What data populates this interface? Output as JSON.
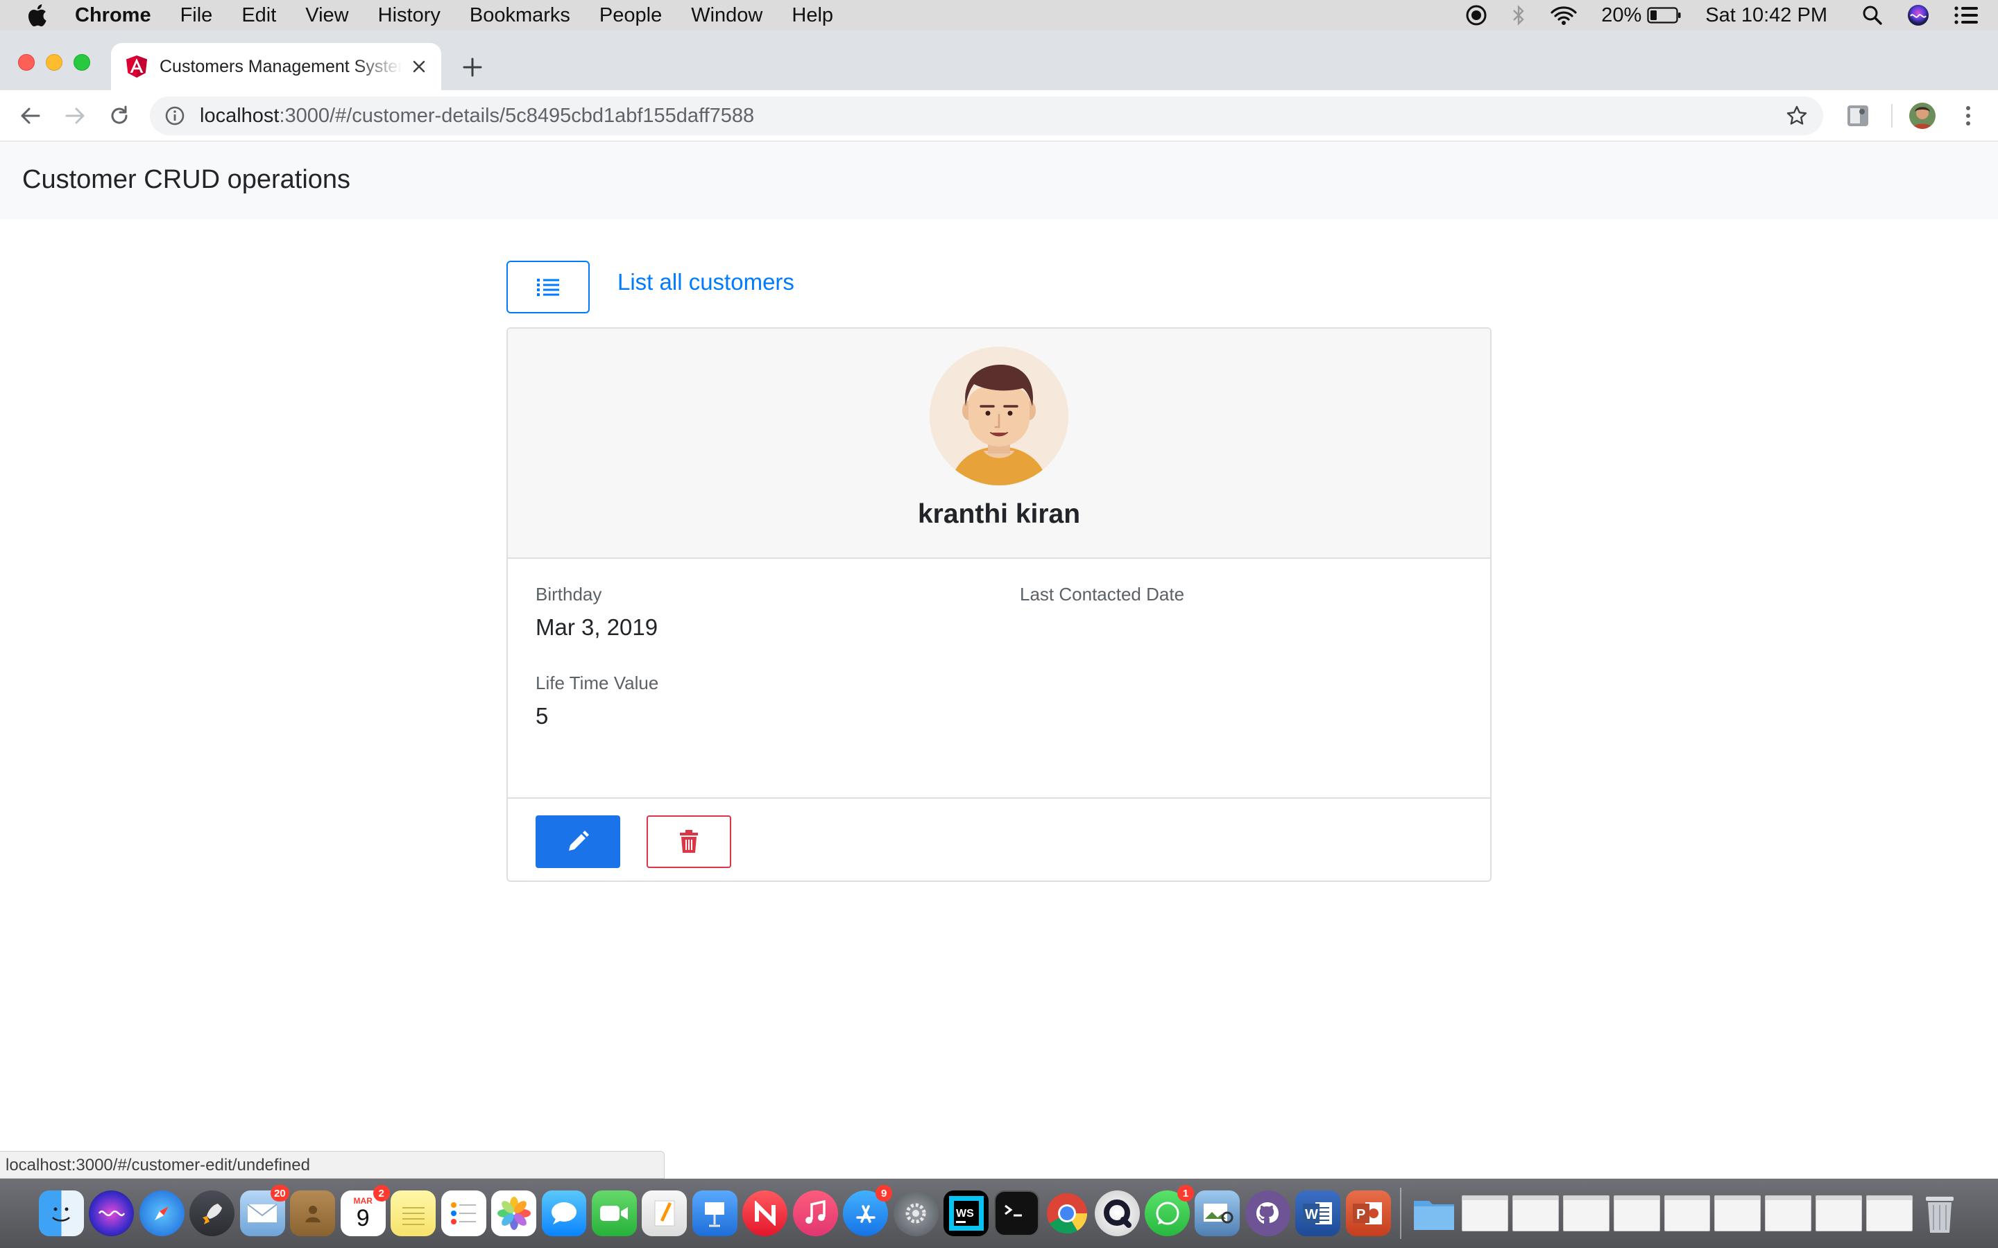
{
  "menubar": {
    "app_name": "Chrome",
    "items": [
      "File",
      "Edit",
      "View",
      "History",
      "Bookmarks",
      "People",
      "Window",
      "Help"
    ],
    "battery": "20%",
    "clock": "Sat 10:42 PM"
  },
  "browser": {
    "tab_title": "Customers Management System",
    "url_host": "localhost",
    "url_path": ":3000/#/customer-details/5c8495cbd1abf155daff7588",
    "status_url": "localhost:3000/#/customer-edit/undefined"
  },
  "app": {
    "brand": "Customer CRUD operations",
    "list_link": "List all customers"
  },
  "customer": {
    "name": "kranthi kiran",
    "fields": {
      "birthday_label": "Birthday",
      "birthday_value": "Mar 3, 2019",
      "last_contacted_label": "Last Contacted Date",
      "last_contacted_value": "",
      "ltv_label": "Life Time Value",
      "ltv_value": "5"
    }
  },
  "icons": {
    "list_button": "list-icon",
    "edit_button": "pencil-icon",
    "delete_button": "trash-icon"
  },
  "colors": {
    "primary": "#007bff",
    "edit_button": "#1a73e8",
    "danger": "#dc3545"
  },
  "dock": {
    "calendar_month": "MAR",
    "calendar_day": "9",
    "badges": {
      "mail": "20",
      "calendar": "2",
      "app_store": "9",
      "whatsapp": "1"
    }
  }
}
